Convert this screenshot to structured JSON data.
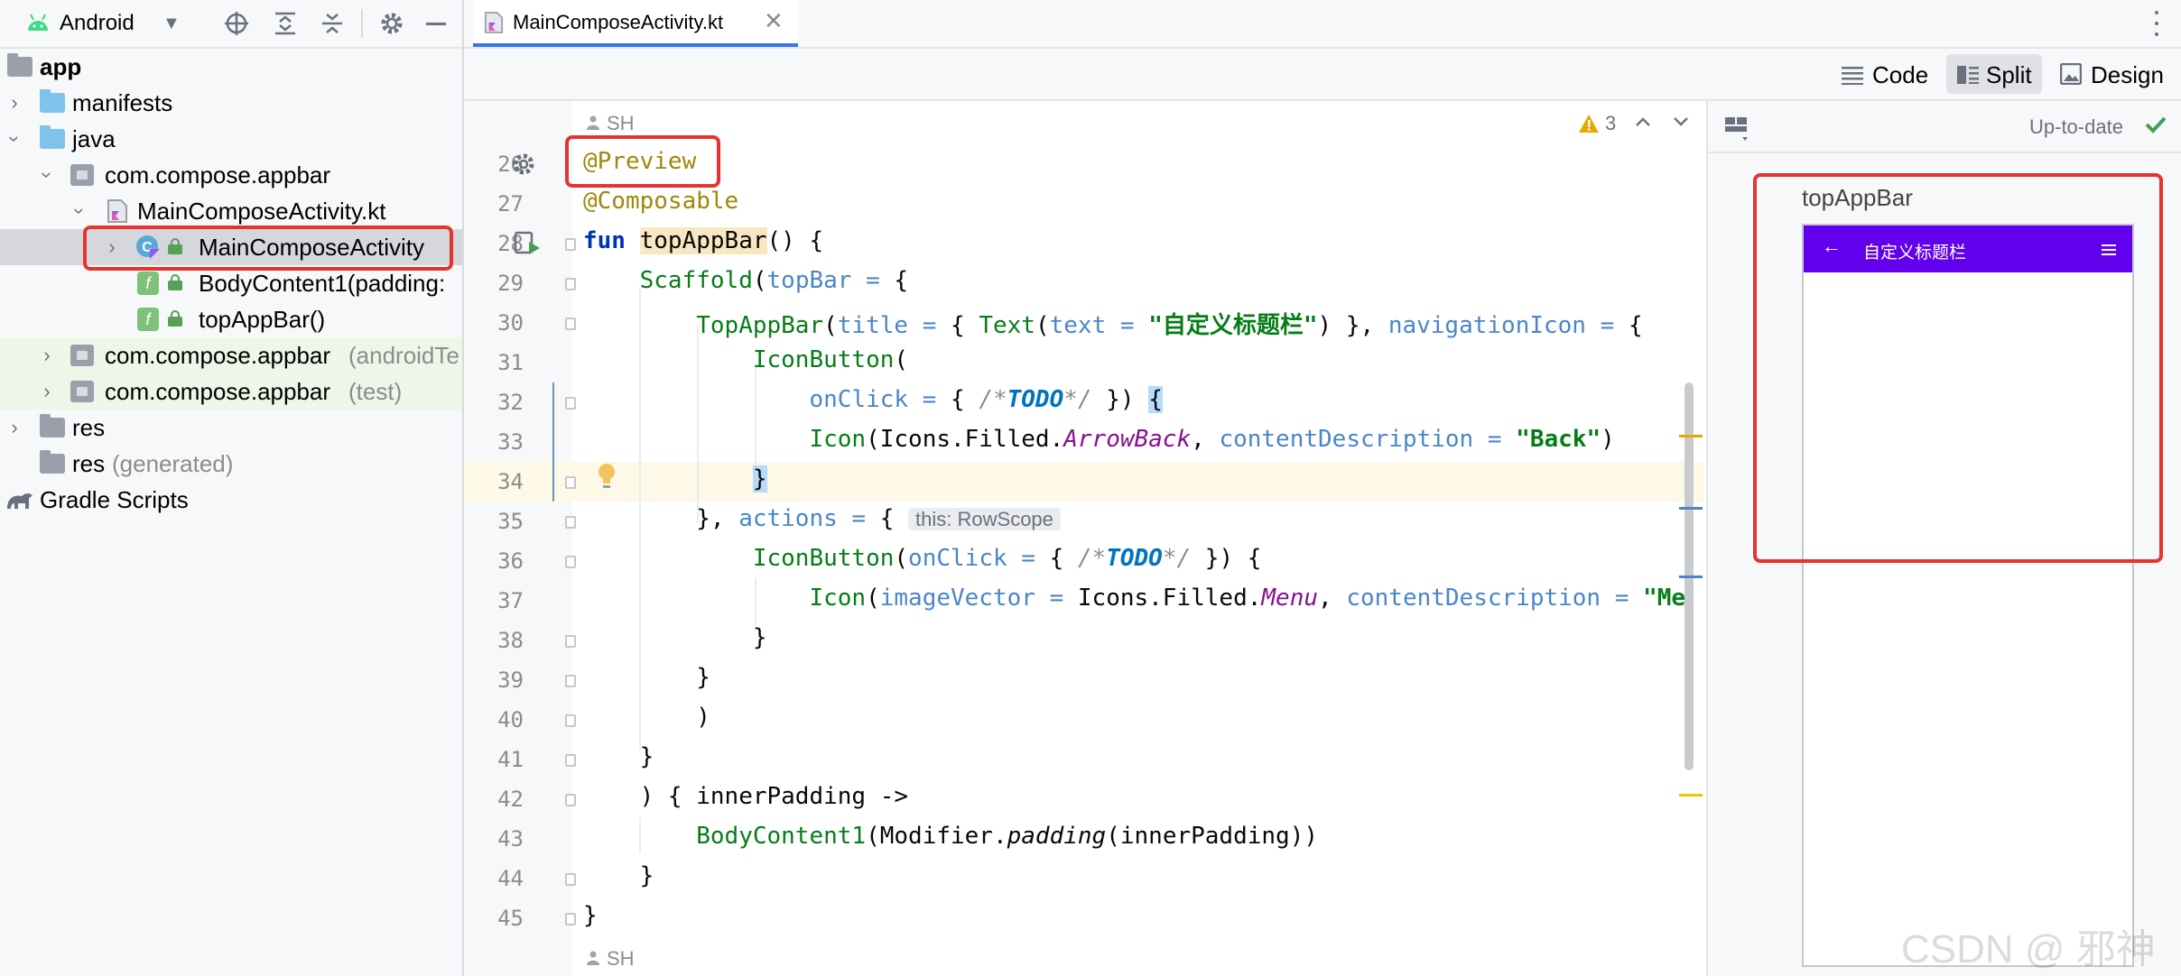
{
  "project_toolbar": {
    "view_label": "Android"
  },
  "tree": {
    "app": "app",
    "manifests": "manifests",
    "java": "java",
    "package_main": "com.compose.appbar",
    "file_kt": "MainComposeActivity.kt",
    "class_activity": "MainComposeActivity",
    "fn_body": "BodyContent1(padding:",
    "fn_topbar": "topAppBar()",
    "package_android_test": "com.compose.appbar",
    "package_android_test_suffix": "(androidTe",
    "package_test": "com.compose.appbar",
    "package_test_suffix": "(test)",
    "res": "res",
    "res_generated": "res",
    "res_generated_suffix": "(generated)",
    "gradle": "Gradle Scripts"
  },
  "editor_tab": {
    "label": "MainComposeActivity.kt"
  },
  "view_modes": {
    "code": "Code",
    "split": "Split",
    "design": "Design"
  },
  "editor": {
    "author": "SH",
    "warnings_count": "3",
    "line_numbers": [
      "26",
      "27",
      "28",
      "29",
      "30",
      "31",
      "32",
      "33",
      "34",
      "35",
      "36",
      "37",
      "38",
      "39",
      "40",
      "41",
      "42",
      "43",
      "44",
      "45"
    ],
    "tokens": {
      "preview": "@Preview",
      "composable": "@Composable",
      "fun": "fun",
      "topAppBar": "topAppBar",
      "scaffold": "Scaffold",
      "topBar": "topBar",
      "topAppBarCall": "TopAppBar",
      "title": "title",
      "text_fn": "Text",
      "text_param": "text",
      "title_str": "\"自定义标题栏\"",
      "navigationIcon": "navigationIcon",
      "iconButton": "IconButton",
      "onClick": "onClick",
      "todo": "TODO",
      "icon": "Icon",
      "icons_filled": "Icons.Filled.",
      "arrowBack": "ArrowBack",
      "contentDescription": "contentDescription",
      "back_str": "\"Back\"",
      "actions": "actions",
      "row_scope_hint": "this: RowScope",
      "imageVector": "imageVector",
      "menu": "Menu",
      "me_str": "\"Me",
      "innerPadding": "innerPadding",
      "bodyContent": "BodyContent1",
      "modifier": "Modifier.",
      "padding": "padding"
    }
  },
  "preview_panel": {
    "status": "Up-to-date",
    "preview_name": "topAppBar",
    "appbar_title": "自定义标题栏",
    "appbar_color": "#6200ee"
  },
  "watermark": "CSDN @ 邪神"
}
